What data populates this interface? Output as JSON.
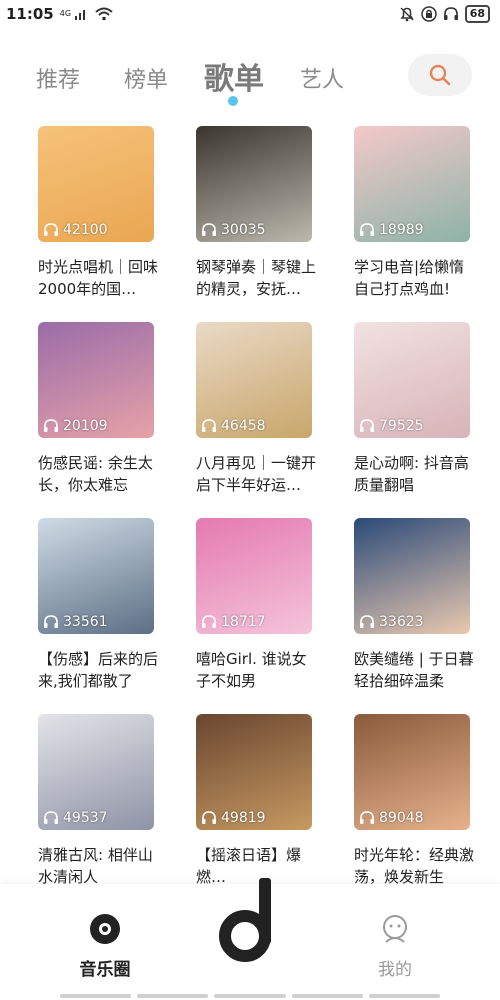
{
  "status_bar": {
    "time": "11:05",
    "network": "4G",
    "battery": "68",
    "icons": [
      "sim-signal-icon",
      "wifi-icon",
      "bell-icon",
      "lock-icon",
      "headphones-icon"
    ]
  },
  "tabs": [
    {
      "label": "推荐",
      "active": false
    },
    {
      "label": "榜单",
      "active": false
    },
    {
      "label": "歌单",
      "active": true
    },
    {
      "label": "艺人",
      "active": false
    }
  ],
  "search": {
    "icon": "search-icon",
    "accent": "#e8845a"
  },
  "playlists": [
    {
      "plays": "42100",
      "title": "时光点唱机｜回味2000年的国…",
      "cover": [
        "#f6c27a",
        "#e9a652"
      ]
    },
    {
      "plays": "30035",
      "title": "钢琴弹奏｜琴键上的精灵，安抚…",
      "cover": [
        "#3a3530",
        "#bdb8ad"
      ]
    },
    {
      "plays": "18989",
      "title": "学习电音|给懒惰自己打点鸡血!",
      "cover": [
        "#f3c9c9",
        "#8db3a8"
      ]
    },
    {
      "plays": "20109",
      "title": "伤感民谣: 余生太长，你太难忘",
      "cover": [
        "#9a6ca8",
        "#e6a2a8"
      ]
    },
    {
      "plays": "46458",
      "title": "八月再见｜一键开启下半年好运…",
      "cover": [
        "#e9d9c6",
        "#c9a66a"
      ]
    },
    {
      "plays": "79525",
      "title": "是心动啊: 抖音高质量翻唱",
      "cover": [
        "#f2e2e2",
        "#d7b3b8"
      ]
    },
    {
      "plays": "33561",
      "title": "【伤感】后来的后来,我们都散了",
      "cover": [
        "#cfdbe6",
        "#5c6f84"
      ]
    },
    {
      "plays": "18717",
      "title": "嘻哈Girl. 谁说女子不如男",
      "cover": [
        "#e47ab0",
        "#f4c4da"
      ]
    },
    {
      "plays": "33623",
      "title": "欧美缱绻 | 于日暮轻拾细碎温柔",
      "cover": [
        "#2b4a78",
        "#e9c9b0"
      ]
    },
    {
      "plays": "49537",
      "title": "清雅古风: 相伴山水清闲人",
      "cover": [
        "#e3e3e8",
        "#8e93a6"
      ]
    },
    {
      "plays": "49819",
      "title": "【摇滚日语】爆燃…",
      "cover": [
        "#6a4630",
        "#c79a62"
      ]
    },
    {
      "plays": "89048",
      "title": "时光年轮：经典激荡，焕发新生",
      "cover": [
        "#8a5a3c",
        "#e5b28c"
      ]
    }
  ],
  "bottom_nav": {
    "left_label": "音乐圈",
    "right_label": "我的",
    "center_icon": "music-note-logo-icon"
  }
}
